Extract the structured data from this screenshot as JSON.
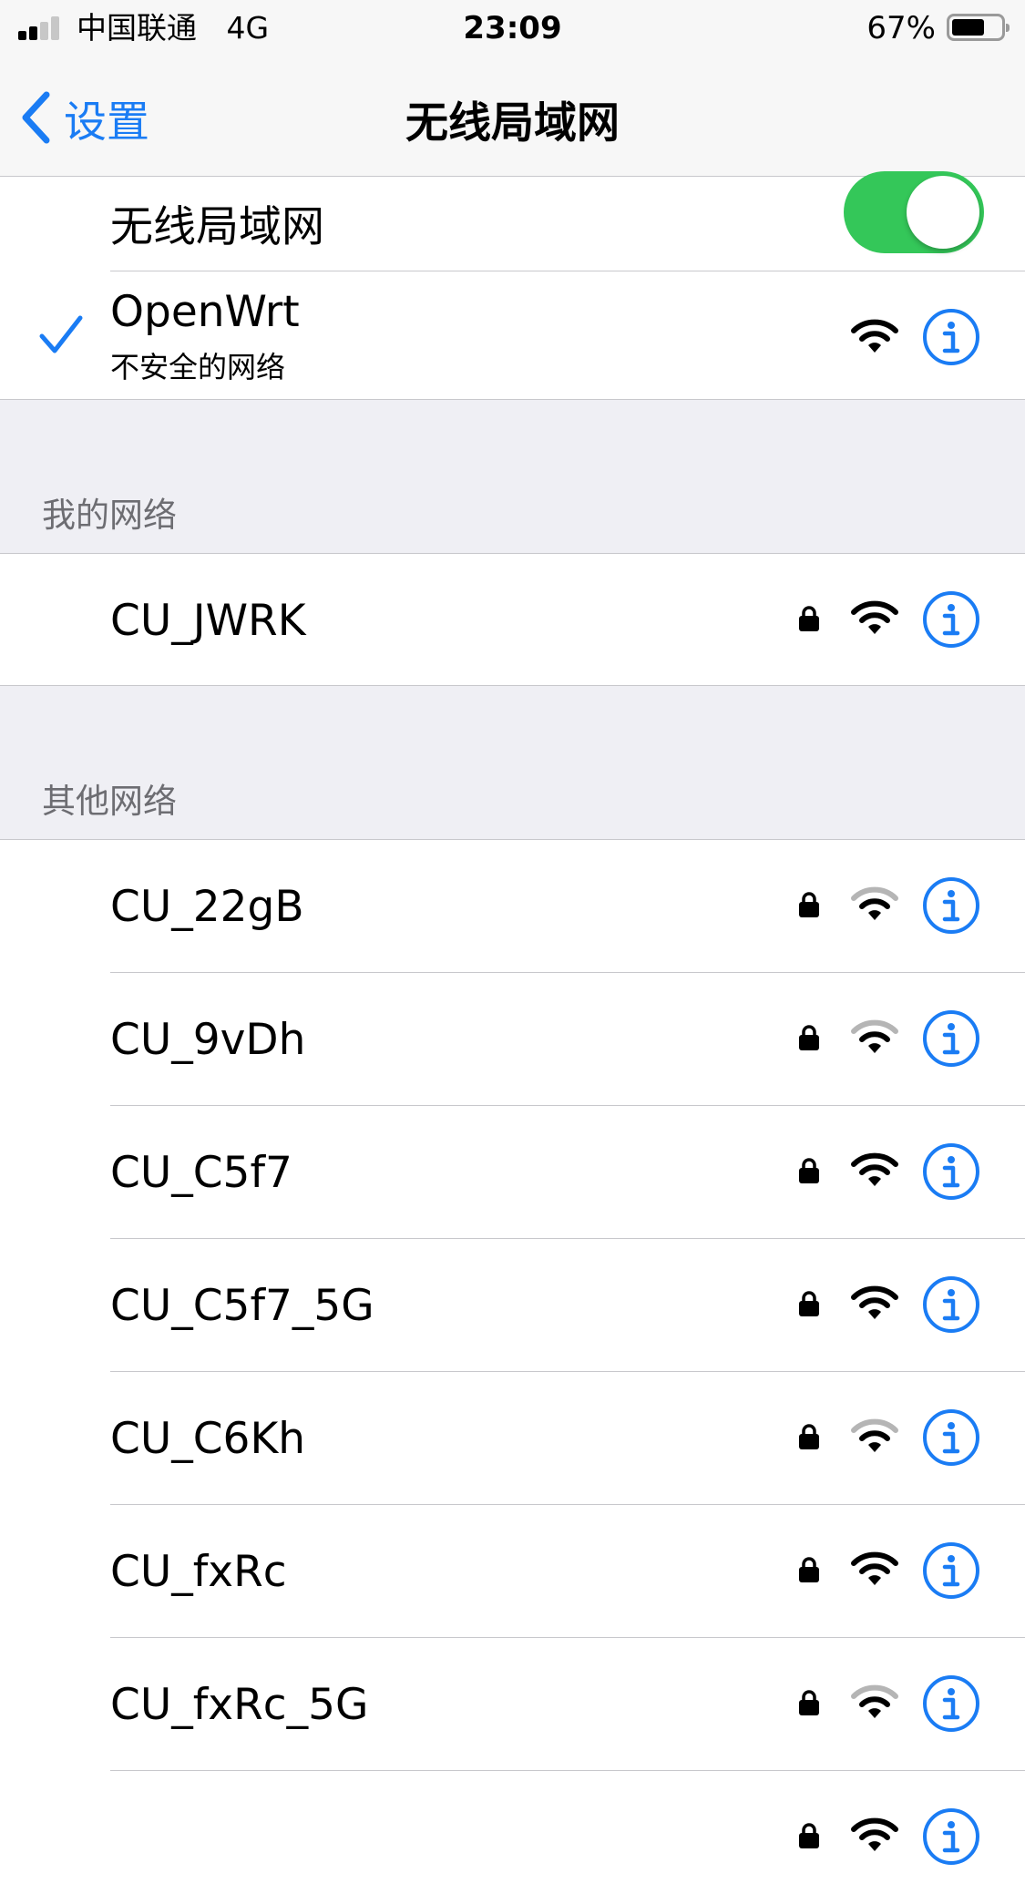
{
  "status_bar": {
    "carrier": "中国联通",
    "network": "4G",
    "time": "23:09",
    "battery": "67%",
    "battery_level": 0.67,
    "signal_bars": 2
  },
  "nav": {
    "back_label": "设置",
    "title": "无线局域网"
  },
  "wifi_toggle": {
    "label": "无线局域网",
    "on": true
  },
  "connected": {
    "name": "OpenWrt",
    "subtitle": "不安全的网络",
    "signal": "strong"
  },
  "my_networks": {
    "header": "我的网络",
    "items": [
      {
        "name": "CU_JWRK",
        "locked": true,
        "signal": "strong"
      }
    ]
  },
  "other_networks": {
    "header": "其他网络",
    "items": [
      {
        "name": "CU_22gB",
        "locked": true,
        "signal": "weak"
      },
      {
        "name": "CU_9vDh",
        "locked": true,
        "signal": "weak"
      },
      {
        "name": "CU_C5f7",
        "locked": true,
        "signal": "strong"
      },
      {
        "name": "CU_C5f7_5G",
        "locked": true,
        "signal": "strong"
      },
      {
        "name": "CU_C6Kh",
        "locked": true,
        "signal": "weak"
      },
      {
        "name": "CU_fxRc",
        "locked": true,
        "signal": "strong"
      },
      {
        "name": "CU_fxRc_5G",
        "locked": true,
        "signal": "weak"
      }
    ]
  },
  "colors": {
    "accent": "#1a7cf4",
    "toggle_on": "#34c759",
    "group_bg": "#efeff4",
    "separator": "#c8c8cc"
  }
}
